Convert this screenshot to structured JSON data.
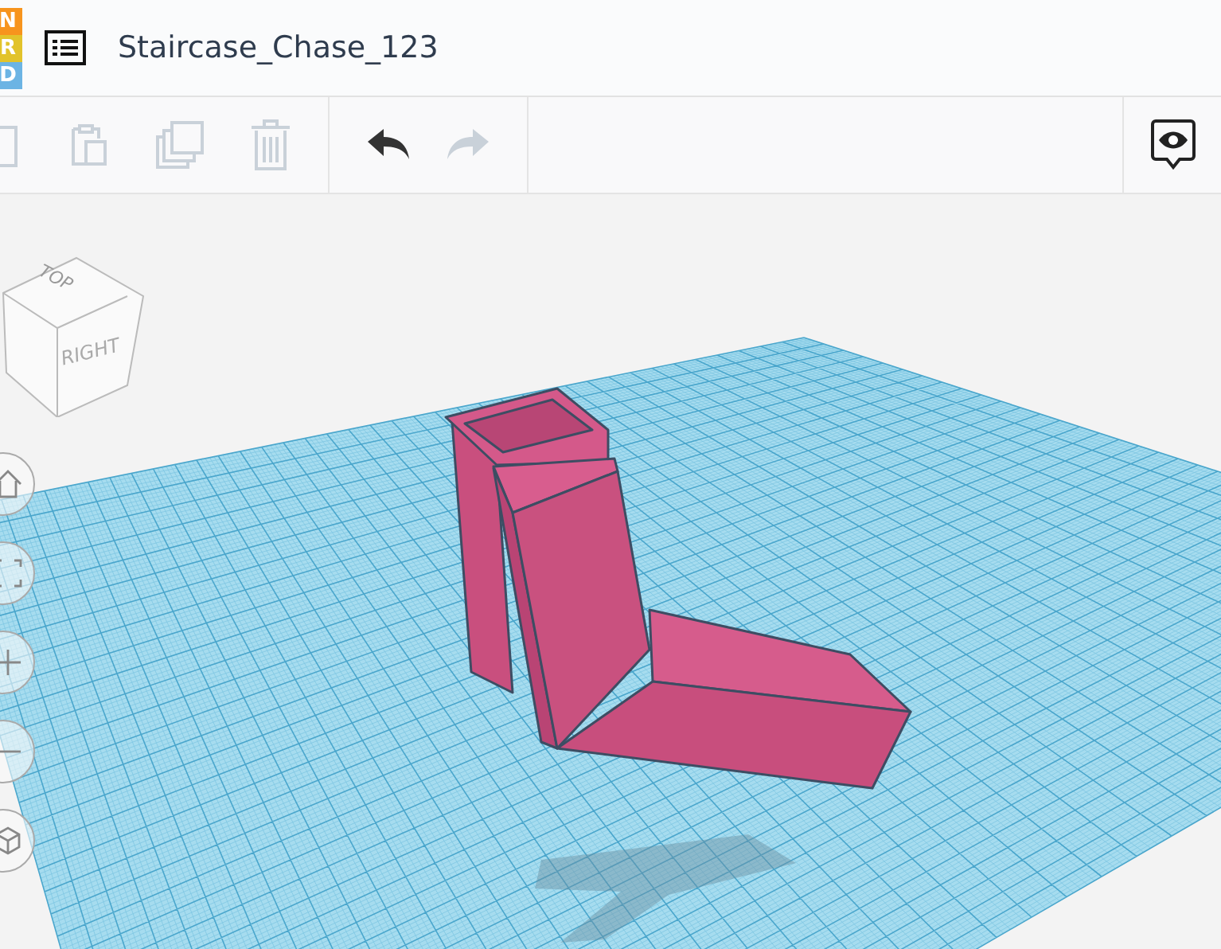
{
  "logo": {
    "letters": [
      {
        "text": "N",
        "color": "#f7941d"
      },
      {
        "text": "R",
        "color": "#e2c32b"
      },
      {
        "text": "D",
        "color": "#6cb4e4"
      }
    ]
  },
  "design": {
    "title": "Staircase_Chase_123"
  },
  "toolbar": [
    {
      "kind": "copy",
      "disabled": true
    },
    {
      "kind": "paste",
      "disabled": true
    },
    {
      "kind": "duplicate",
      "disabled": true
    },
    {
      "kind": "delete",
      "disabled": true
    },
    {
      "kind": "undo",
      "disabled": false
    },
    {
      "kind": "redo",
      "disabled": true
    }
  ],
  "view_cube": {
    "top": "TOP",
    "right": "RIGHT"
  },
  "view_controls": [
    {
      "kind": "home"
    },
    {
      "kind": "fit"
    },
    {
      "kind": "zoom-in"
    },
    {
      "kind": "zoom-out"
    },
    {
      "kind": "perspective"
    }
  ]
}
